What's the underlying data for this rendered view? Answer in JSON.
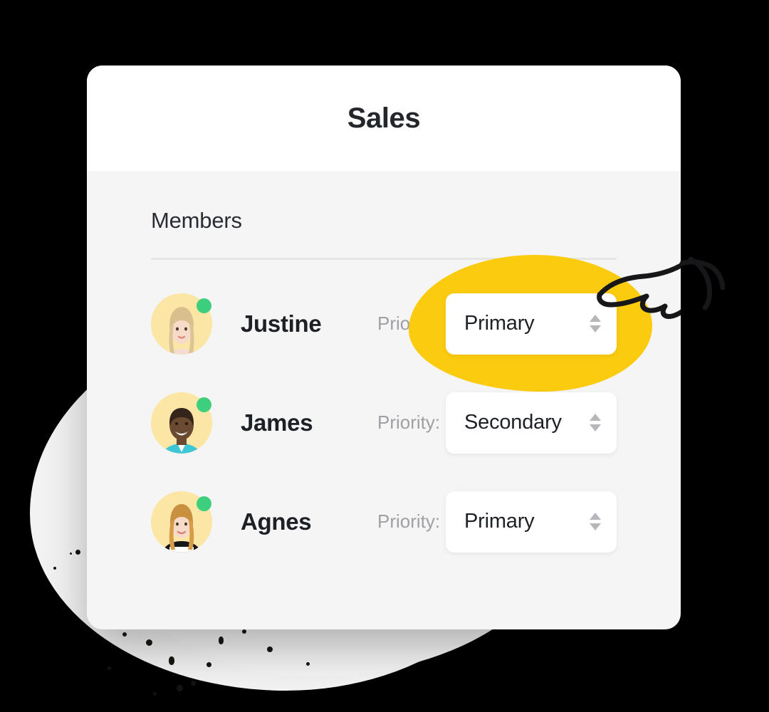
{
  "window": {
    "title": "Sales"
  },
  "section": {
    "heading": "Members"
  },
  "colors": {
    "accent_yellow": "#fbcb10",
    "avatar_background": "#fce6a5",
    "status_online": "#3ecf7e",
    "card_background": "#f5f5f5",
    "header_background": "#ffffff",
    "text_primary": "#1d2025",
    "text_muted": "#9ea0a3",
    "divider": "#e5e5e5",
    "page_background": "#000000",
    "blob_background": "#f2f2f2"
  },
  "members": [
    {
      "name": "Justine",
      "priority_label": "Priority:",
      "priority_value": "Primary",
      "status": "online",
      "highlighted": true
    },
    {
      "name": "James",
      "priority_label": "Priority:",
      "priority_value": "Secondary",
      "status": "online",
      "highlighted": false
    },
    {
      "name": "Agnes",
      "priority_label": "Priority:",
      "priority_value": "Primary",
      "status": "online",
      "highlighted": false
    }
  ],
  "priority_options": [
    "Primary",
    "Secondary"
  ],
  "icons": {
    "stepper": "stepper-up-down-icon",
    "pointer": "pointing-hand-icon",
    "status": "online-status-dot-icon",
    "avatar": "avatar-icon"
  }
}
